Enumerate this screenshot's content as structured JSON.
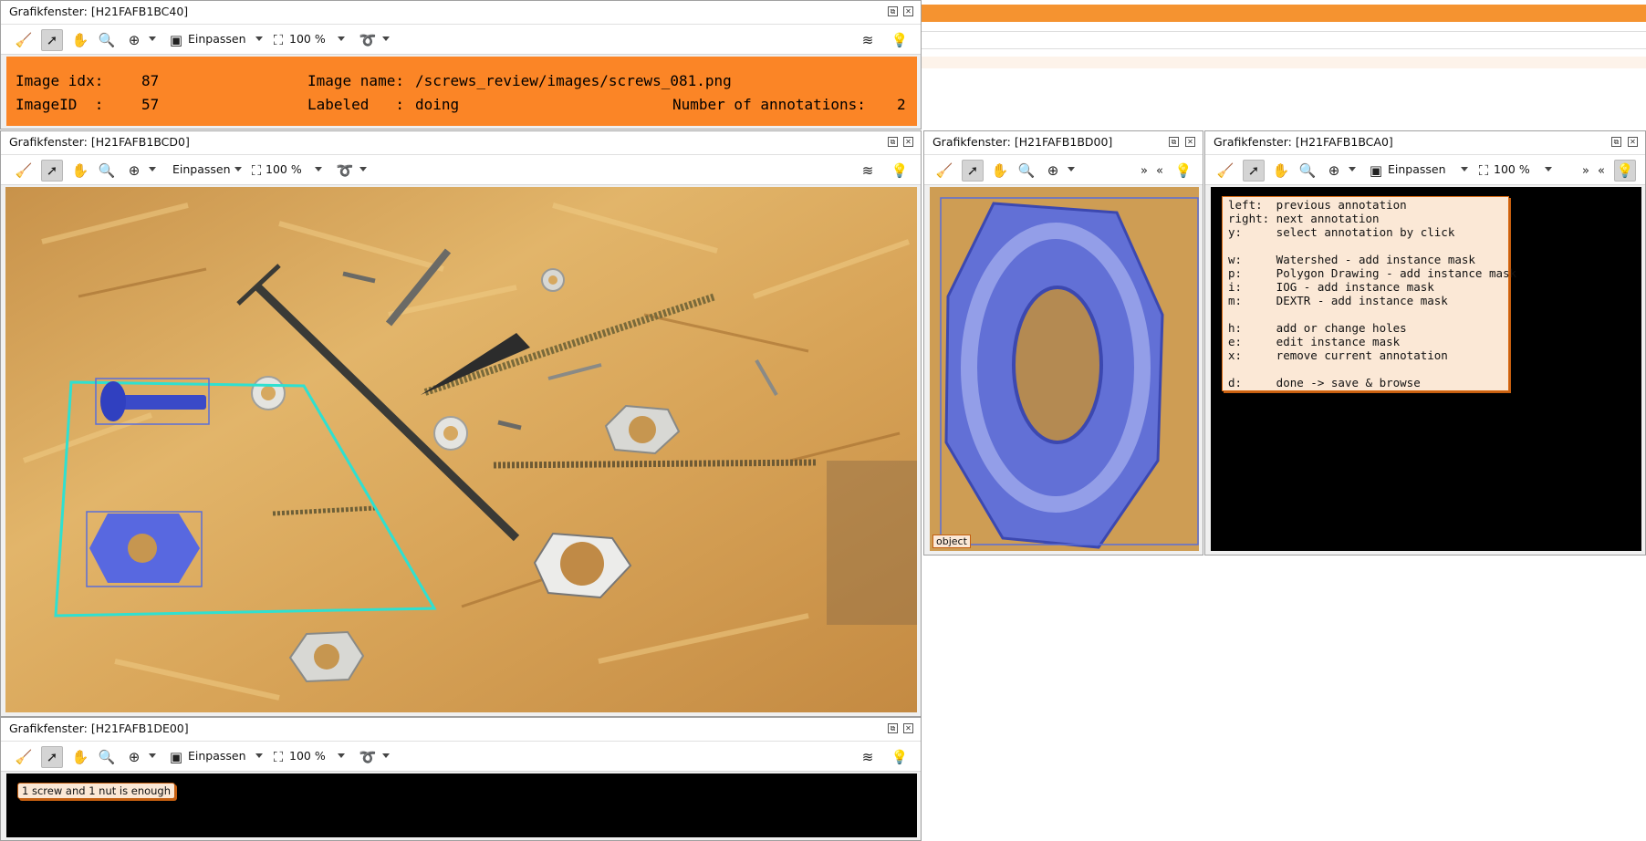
{
  "colors": {
    "banner": "#fb8526",
    "bg_strip_top": "#f59330",
    "bg_strip_light": "#fdf3ea",
    "annotation_polygon": "#2fe0d0",
    "annotation_box": "#5a6ed8",
    "mask": "#4a5bdc"
  },
  "windows": {
    "top": {
      "title": "Grafikfenster: [H21FAFB1BC40]",
      "fit": "Einpassen",
      "zoom": "100 %"
    },
    "main": {
      "title": "Grafikfenster: [H21FAFB1BCD0]",
      "fit": "Einpassen",
      "zoom": "100 %"
    },
    "crop": {
      "title": "Grafikfenster: [H21FAFB1BD00]",
      "label": "object"
    },
    "help": {
      "title": "Grafikfenster: [H21FAFB1BCA0]",
      "fit": "Einpassen",
      "zoom": "100 %"
    },
    "bottom": {
      "title": "Grafikfenster: [H21FAFB1DE00]",
      "fit": "Einpassen",
      "zoom": "100 %",
      "message": "1 screw and 1 nut is enough"
    }
  },
  "banner": {
    "idx_label": "Image idx:",
    "idx_value": "87",
    "id_label": "ImageID  :",
    "id_value": "57",
    "name_label": "Image name:",
    "name_value": "/screws_review/images/screws_081.png",
    "labeled_label": "Labeled   :",
    "labeled_value": "doing",
    "annotations_label": "Number of annotations:",
    "annotations_value": "2"
  },
  "hotkeys": [
    "left:  previous annotation",
    "right: next annotation",
    "y:     select annotation by click",
    "",
    "w:     Watershed - add instance mask",
    "p:     Polygon Drawing - add instance mask",
    "i:     IOG - add instance mask",
    "m:     DEXTR - add instance mask",
    "",
    "h:     add or change holes",
    "e:     edit instance mask",
    "x:     remove current annotation",
    "",
    "d:     done -> save & browse"
  ],
  "icons": [
    "broom-icon",
    "pointer-icon",
    "hand-icon",
    "magnifier-icon",
    "zoom-in-icon",
    "fit-icon",
    "zoom-percent-icon",
    "lasso-icon",
    "layers-icon",
    "lightbulb-icon"
  ]
}
